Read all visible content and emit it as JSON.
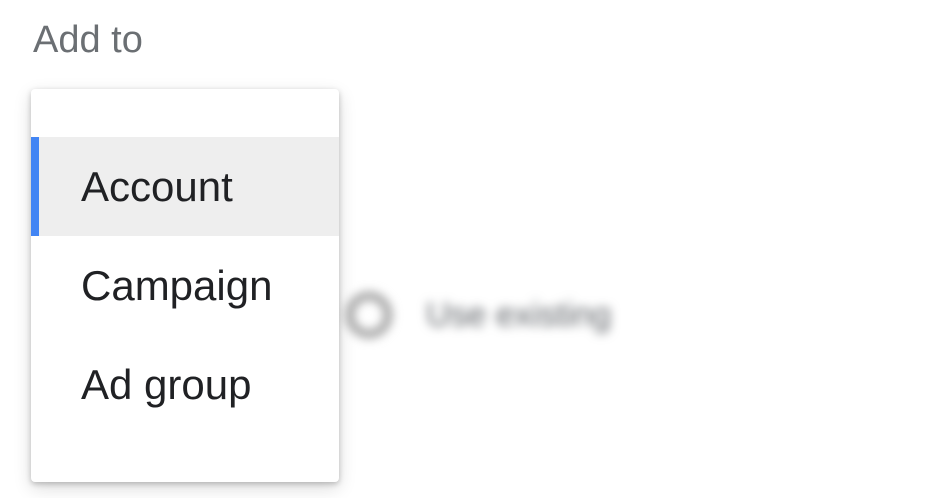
{
  "field": {
    "label": "Add to"
  },
  "menu": {
    "items": [
      {
        "label": "Account",
        "selected": true
      },
      {
        "label": "Campaign",
        "selected": false
      },
      {
        "label": "Ad group",
        "selected": false
      }
    ]
  },
  "background": {
    "option_label": "Use existing"
  },
  "colors": {
    "selection_accent": "#4285f4",
    "selected_bg": "#eeeeee",
    "label_text": "#6b6f73",
    "item_text": "#202124"
  }
}
